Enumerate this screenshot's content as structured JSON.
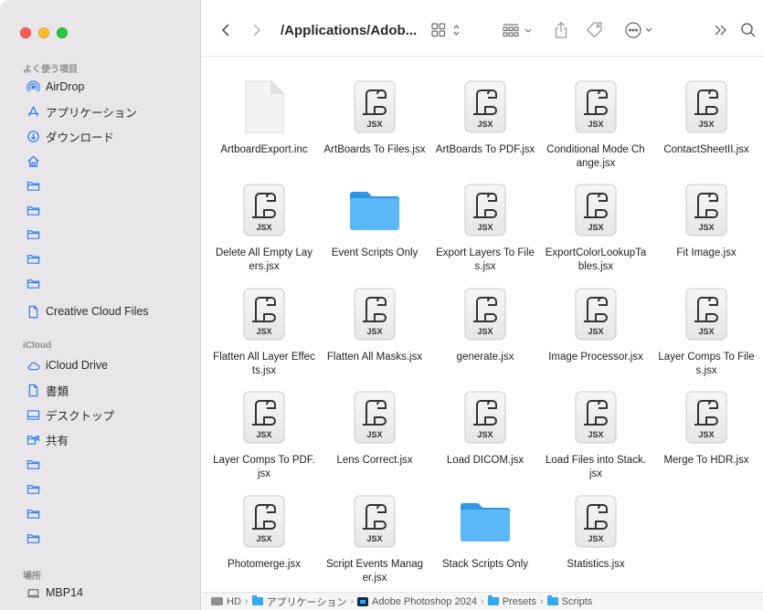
{
  "toolbar": {
    "path_title": "/Applications/Adob...",
    "back_icon": "chevron-left-icon",
    "forward_icon": "chevron-right-icon"
  },
  "sidebar": {
    "favorites_header": "よく使う項目",
    "favorites": [
      {
        "label": "AirDrop",
        "icon": "airdrop-icon"
      },
      {
        "label": "アプリケーション",
        "icon": "applications-icon"
      },
      {
        "label": "ダウンロード",
        "icon": "download-icon"
      },
      {
        "label": "",
        "icon": "home-icon"
      },
      {
        "label": "",
        "icon": "folder-icon"
      },
      {
        "label": "",
        "icon": "folder-icon"
      },
      {
        "label": "",
        "icon": "folder-icon"
      },
      {
        "label": "",
        "icon": "folder-icon"
      },
      {
        "label": "",
        "icon": "folder-icon"
      },
      {
        "label": "Creative Cloud Files",
        "icon": "document-icon"
      }
    ],
    "icloud_header": "iCloud",
    "icloud": [
      {
        "label": "iCloud Drive",
        "icon": "cloud-icon"
      },
      {
        "label": "書類",
        "icon": "document-icon"
      },
      {
        "label": "デスクトップ",
        "icon": "desktop-icon"
      },
      {
        "label": "共有",
        "icon": "shared-folder-icon"
      },
      {
        "label": "",
        "icon": "folder-icon"
      },
      {
        "label": "",
        "icon": "folder-icon"
      },
      {
        "label": "",
        "icon": "folder-icon"
      },
      {
        "label": "",
        "icon": "folder-icon"
      }
    ],
    "locations_header": "場所",
    "locations": [
      {
        "label": "MBP14",
        "icon": "laptop-icon"
      }
    ]
  },
  "files": [
    {
      "name": "ArtboardExport.inc",
      "kind": "blank"
    },
    {
      "name": "ArtBoards To Files.jsx",
      "kind": "jsx"
    },
    {
      "name": "ArtBoards To PDF.jsx",
      "kind": "jsx"
    },
    {
      "name": "Conditional Mode Change.jsx",
      "kind": "jsx"
    },
    {
      "name": "ContactSheetII.jsx",
      "kind": "jsx"
    },
    {
      "name": "Delete All Empty Layers.jsx",
      "kind": "jsx"
    },
    {
      "name": "Event Scripts Only",
      "kind": "folder"
    },
    {
      "name": "Export Layers To Files.jsx",
      "kind": "jsx"
    },
    {
      "name": "ExportColorLookupTables.jsx",
      "kind": "jsx"
    },
    {
      "name": "Fit Image.jsx",
      "kind": "jsx"
    },
    {
      "name": "Flatten All Layer Effects.jsx",
      "kind": "jsx"
    },
    {
      "name": "Flatten All Masks.jsx",
      "kind": "jsx"
    },
    {
      "name": "generate.jsx",
      "kind": "jsx"
    },
    {
      "name": "Image Processor.jsx",
      "kind": "jsx"
    },
    {
      "name": "Layer Comps To Files.jsx",
      "kind": "jsx"
    },
    {
      "name": "Layer Comps To PDF.jsx",
      "kind": "jsx"
    },
    {
      "name": "Lens Correct.jsx",
      "kind": "jsx"
    },
    {
      "name": "Load DICOM.jsx",
      "kind": "jsx"
    },
    {
      "name": "Load Files into Stack.jsx",
      "kind": "jsx"
    },
    {
      "name": "Merge To HDR.jsx",
      "kind": "jsx"
    },
    {
      "name": "Photomerge.jsx",
      "kind": "jsx"
    },
    {
      "name": "Script Events Manager.jsx",
      "kind": "jsx"
    },
    {
      "name": "Stack Scripts Only",
      "kind": "folder"
    },
    {
      "name": "Statistics.jsx",
      "kind": "jsx"
    }
  ],
  "jsx_badge": "JSX",
  "pathbar": [
    {
      "label": "HD",
      "icon": "hd-icon"
    },
    {
      "label": "アプリケーション",
      "icon": "folder-icon"
    },
    {
      "label": "Adobe Photoshop 2024",
      "icon": "photoshop-icon"
    },
    {
      "label": "Presets",
      "icon": "folder-icon"
    },
    {
      "label": "Scripts",
      "icon": "folder-icon"
    }
  ],
  "colors": {
    "accent": "#2f7cf6",
    "folder": "#3aaaf4",
    "sidebar_bg": "#e9e6ea"
  }
}
